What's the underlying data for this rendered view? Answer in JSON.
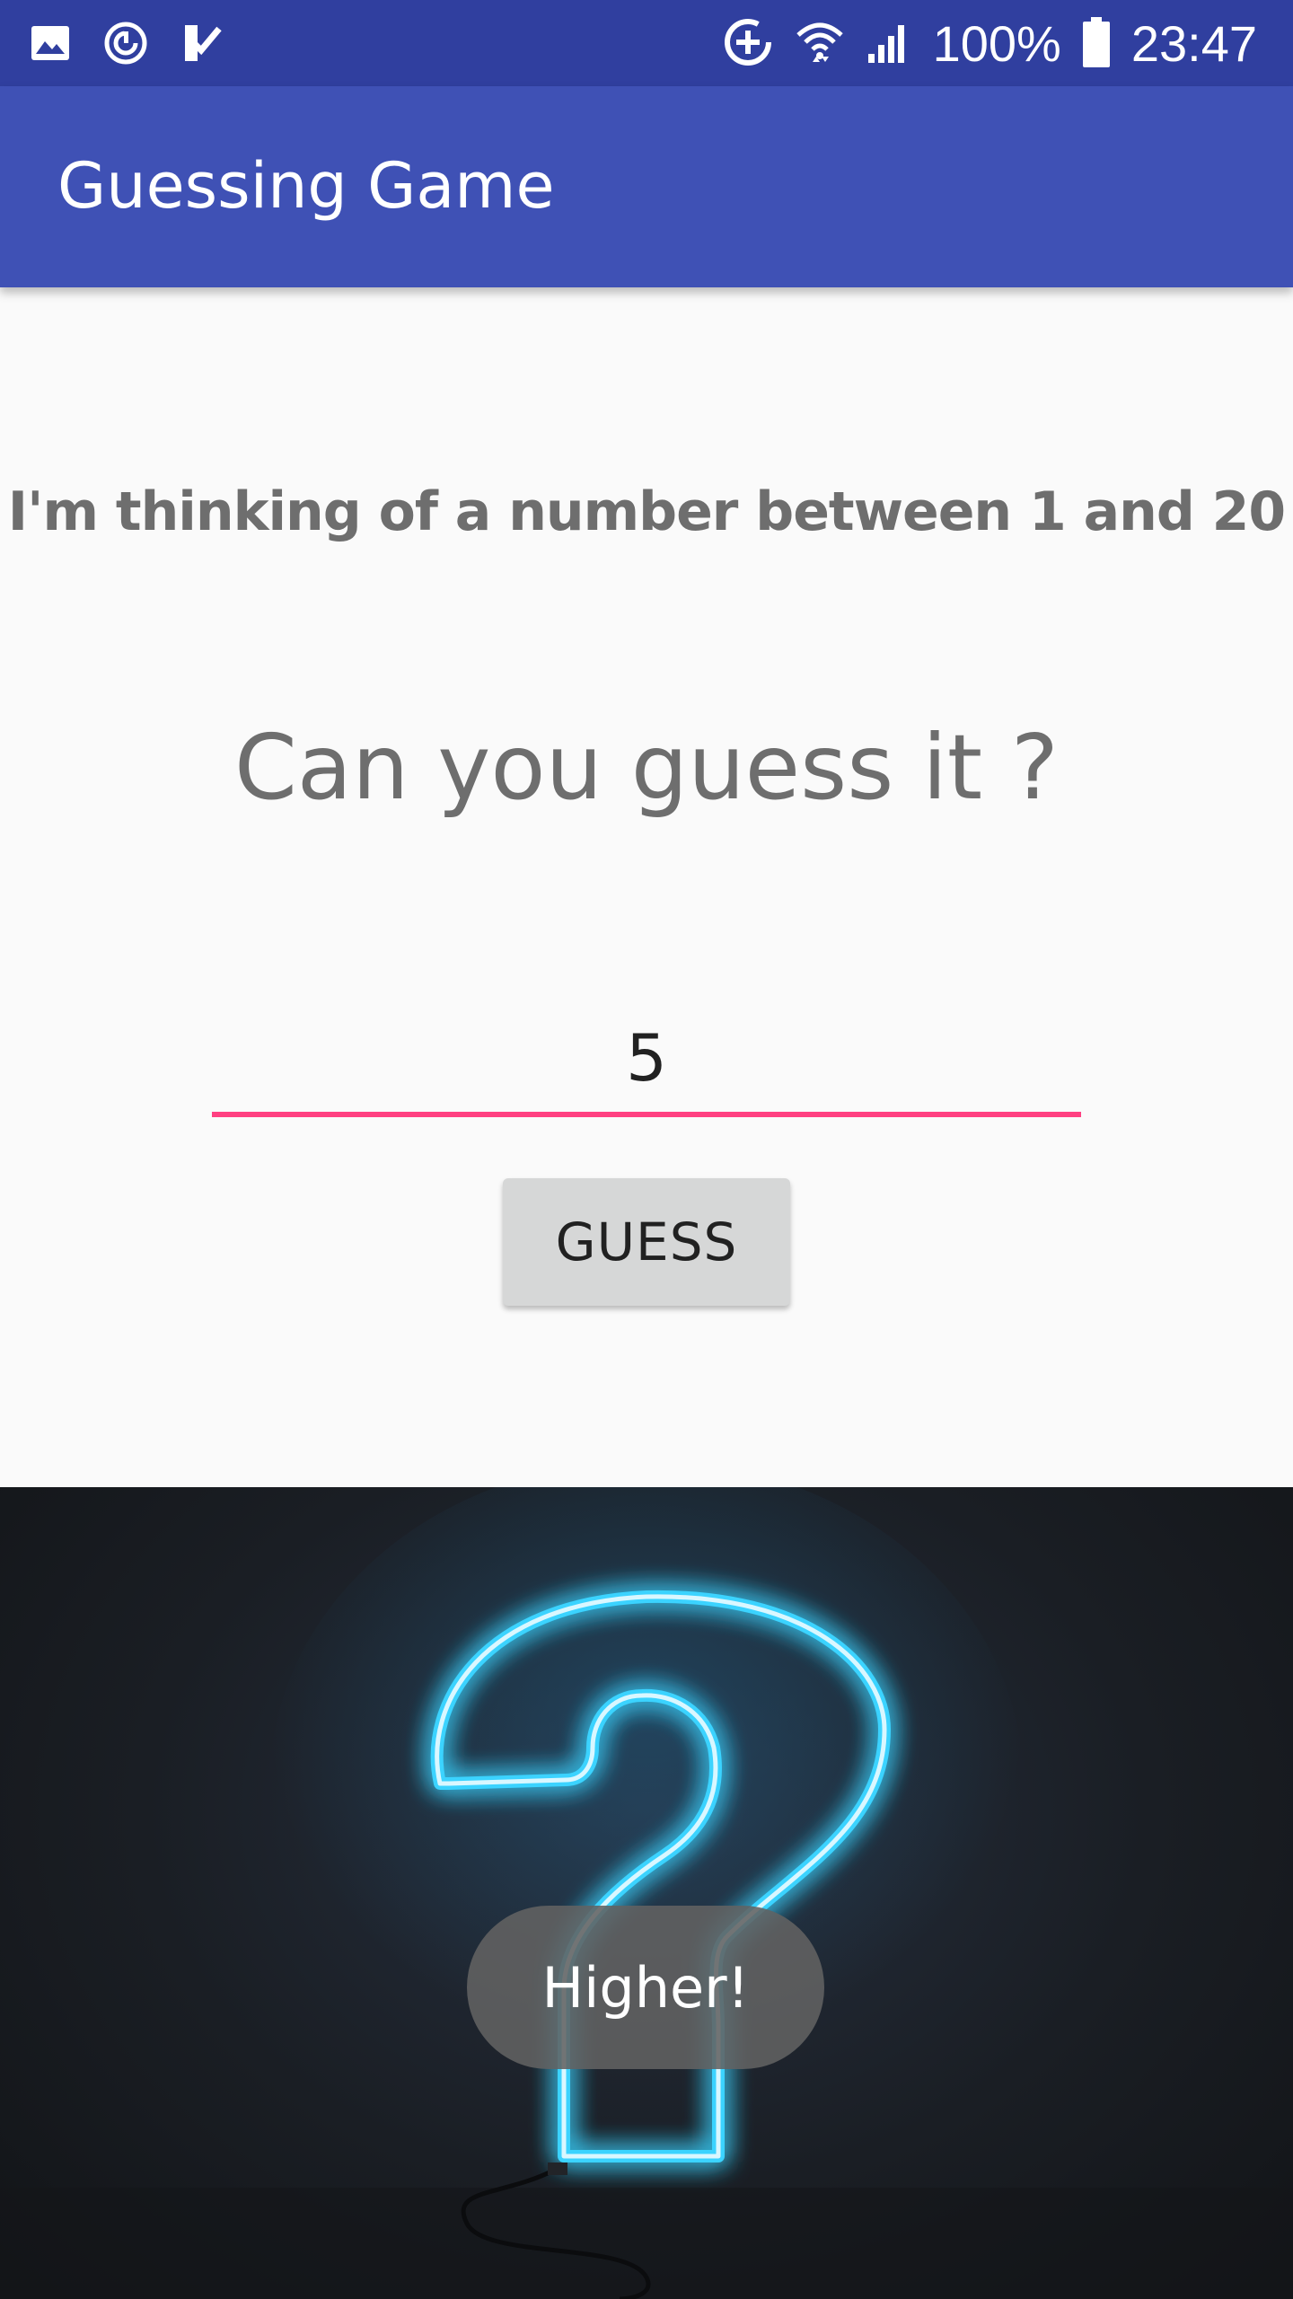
{
  "status_bar": {
    "battery_percent": "100%",
    "time": "23:47",
    "left_icons": [
      "gallery-icon",
      "sync-icon",
      "checklist-icon"
    ],
    "right_icons": [
      "data-saver-icon",
      "wifi-icon",
      "cellular-signal-icon",
      "battery-icon"
    ]
  },
  "app_bar": {
    "title": "Guessing Game",
    "color": "#3f51b5",
    "status_color": "#303f9f"
  },
  "main": {
    "prompt": "I'm thinking of a number between 1 and 20",
    "headline": "Can you guess it ?",
    "guess_input": {
      "value": "5",
      "placeholder": ""
    },
    "guess_button_label": "GUESS",
    "accent_color": "#ff4081"
  },
  "image": {
    "icon": "neon-question-mark-icon"
  },
  "toast": {
    "message": "Higher!"
  }
}
